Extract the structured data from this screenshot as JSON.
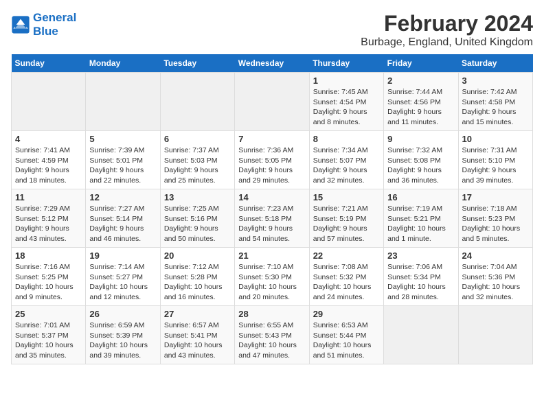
{
  "header": {
    "logo_line1": "General",
    "logo_line2": "Blue",
    "title": "February 2024",
    "subtitle": "Burbage, England, United Kingdom"
  },
  "weekdays": [
    "Sunday",
    "Monday",
    "Tuesday",
    "Wednesday",
    "Thursday",
    "Friday",
    "Saturday"
  ],
  "weeks": [
    [
      {
        "num": "",
        "info": ""
      },
      {
        "num": "",
        "info": ""
      },
      {
        "num": "",
        "info": ""
      },
      {
        "num": "",
        "info": ""
      },
      {
        "num": "1",
        "info": "Sunrise: 7:45 AM\nSunset: 4:54 PM\nDaylight: 9 hours\nand 8 minutes."
      },
      {
        "num": "2",
        "info": "Sunrise: 7:44 AM\nSunset: 4:56 PM\nDaylight: 9 hours\nand 11 minutes."
      },
      {
        "num": "3",
        "info": "Sunrise: 7:42 AM\nSunset: 4:58 PM\nDaylight: 9 hours\nand 15 minutes."
      }
    ],
    [
      {
        "num": "4",
        "info": "Sunrise: 7:41 AM\nSunset: 4:59 PM\nDaylight: 9 hours\nand 18 minutes."
      },
      {
        "num": "5",
        "info": "Sunrise: 7:39 AM\nSunset: 5:01 PM\nDaylight: 9 hours\nand 22 minutes."
      },
      {
        "num": "6",
        "info": "Sunrise: 7:37 AM\nSunset: 5:03 PM\nDaylight: 9 hours\nand 25 minutes."
      },
      {
        "num": "7",
        "info": "Sunrise: 7:36 AM\nSunset: 5:05 PM\nDaylight: 9 hours\nand 29 minutes."
      },
      {
        "num": "8",
        "info": "Sunrise: 7:34 AM\nSunset: 5:07 PM\nDaylight: 9 hours\nand 32 minutes."
      },
      {
        "num": "9",
        "info": "Sunrise: 7:32 AM\nSunset: 5:08 PM\nDaylight: 9 hours\nand 36 minutes."
      },
      {
        "num": "10",
        "info": "Sunrise: 7:31 AM\nSunset: 5:10 PM\nDaylight: 9 hours\nand 39 minutes."
      }
    ],
    [
      {
        "num": "11",
        "info": "Sunrise: 7:29 AM\nSunset: 5:12 PM\nDaylight: 9 hours\nand 43 minutes."
      },
      {
        "num": "12",
        "info": "Sunrise: 7:27 AM\nSunset: 5:14 PM\nDaylight: 9 hours\nand 46 minutes."
      },
      {
        "num": "13",
        "info": "Sunrise: 7:25 AM\nSunset: 5:16 PM\nDaylight: 9 hours\nand 50 minutes."
      },
      {
        "num": "14",
        "info": "Sunrise: 7:23 AM\nSunset: 5:18 PM\nDaylight: 9 hours\nand 54 minutes."
      },
      {
        "num": "15",
        "info": "Sunrise: 7:21 AM\nSunset: 5:19 PM\nDaylight: 9 hours\nand 57 minutes."
      },
      {
        "num": "16",
        "info": "Sunrise: 7:19 AM\nSunset: 5:21 PM\nDaylight: 10 hours\nand 1 minute."
      },
      {
        "num": "17",
        "info": "Sunrise: 7:18 AM\nSunset: 5:23 PM\nDaylight: 10 hours\nand 5 minutes."
      }
    ],
    [
      {
        "num": "18",
        "info": "Sunrise: 7:16 AM\nSunset: 5:25 PM\nDaylight: 10 hours\nand 9 minutes."
      },
      {
        "num": "19",
        "info": "Sunrise: 7:14 AM\nSunset: 5:27 PM\nDaylight: 10 hours\nand 12 minutes."
      },
      {
        "num": "20",
        "info": "Sunrise: 7:12 AM\nSunset: 5:28 PM\nDaylight: 10 hours\nand 16 minutes."
      },
      {
        "num": "21",
        "info": "Sunrise: 7:10 AM\nSunset: 5:30 PM\nDaylight: 10 hours\nand 20 minutes."
      },
      {
        "num": "22",
        "info": "Sunrise: 7:08 AM\nSunset: 5:32 PM\nDaylight: 10 hours\nand 24 minutes."
      },
      {
        "num": "23",
        "info": "Sunrise: 7:06 AM\nSunset: 5:34 PM\nDaylight: 10 hours\nand 28 minutes."
      },
      {
        "num": "24",
        "info": "Sunrise: 7:04 AM\nSunset: 5:36 PM\nDaylight: 10 hours\nand 32 minutes."
      }
    ],
    [
      {
        "num": "25",
        "info": "Sunrise: 7:01 AM\nSunset: 5:37 PM\nDaylight: 10 hours\nand 35 minutes."
      },
      {
        "num": "26",
        "info": "Sunrise: 6:59 AM\nSunset: 5:39 PM\nDaylight: 10 hours\nand 39 minutes."
      },
      {
        "num": "27",
        "info": "Sunrise: 6:57 AM\nSunset: 5:41 PM\nDaylight: 10 hours\nand 43 minutes."
      },
      {
        "num": "28",
        "info": "Sunrise: 6:55 AM\nSunset: 5:43 PM\nDaylight: 10 hours\nand 47 minutes."
      },
      {
        "num": "29",
        "info": "Sunrise: 6:53 AM\nSunset: 5:44 PM\nDaylight: 10 hours\nand 51 minutes."
      },
      {
        "num": "",
        "info": ""
      },
      {
        "num": "",
        "info": ""
      }
    ]
  ]
}
